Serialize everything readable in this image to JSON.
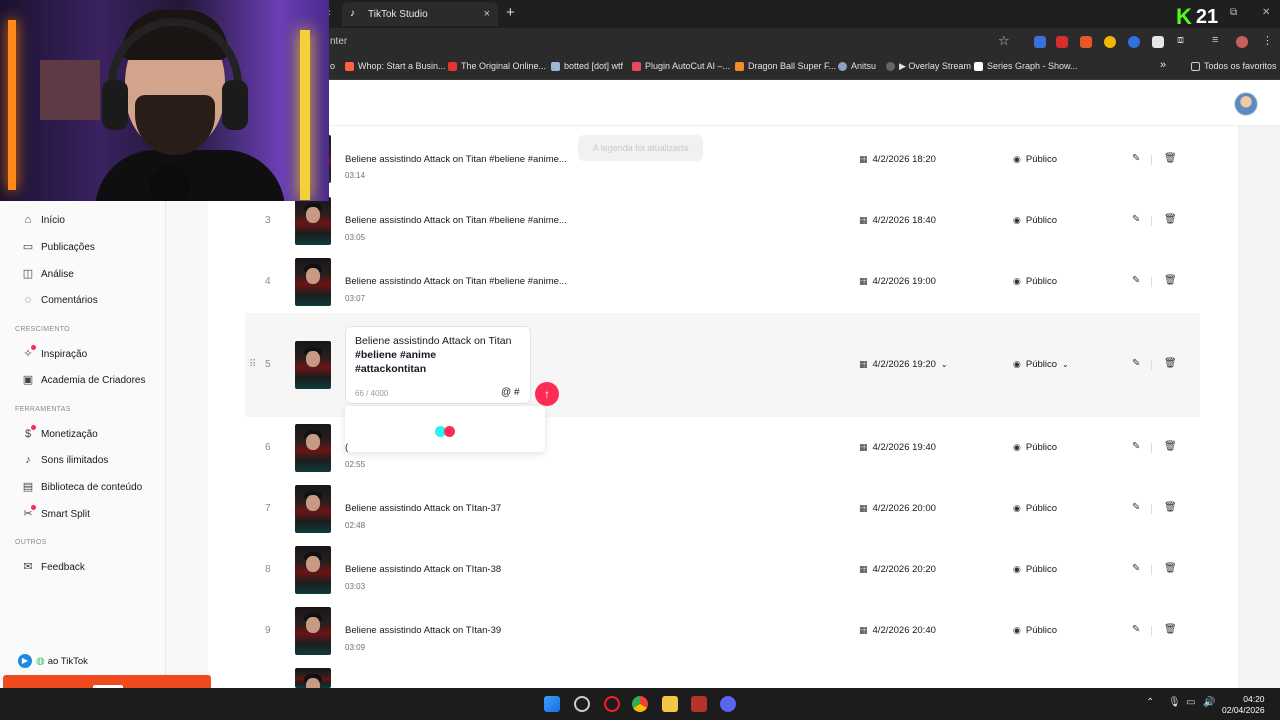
{
  "browser": {
    "tab_title": "TikTok Studio",
    "tab_close": "×",
    "new_tab": "+",
    "url_fragment": "nter",
    "kick_count": "21",
    "bookmarks": [
      {
        "label": "Whop: Start a Busin...",
        "color": "#ff6243"
      },
      {
        "label": "The Original Online...",
        "color": "#e3342f"
      },
      {
        "label": "botted [dot] wtf",
        "color": "#9fb7d6"
      },
      {
        "label": "Plugin AutoCut AI –...",
        "color": "#e84a5f"
      },
      {
        "label": "Dragon Ball Super F...",
        "color": "#f28c28"
      },
      {
        "label": "Anitsu",
        "color": "#8aa3c2"
      },
      {
        "label": "▶ Overlay Stream",
        "color": "#666666"
      },
      {
        "label": "Series Graph - Show...",
        "color": "#ffffff"
      }
    ],
    "bookmarks_more": "»",
    "all_bookmarks": "Todos os favoritos"
  },
  "sidebar": {
    "items": [
      {
        "label": "Início",
        "icon": "home-icon",
        "glyph": "⌂"
      },
      {
        "label": "Publicações",
        "icon": "posts-icon",
        "glyph": "▭"
      },
      {
        "label": "Análise",
        "icon": "analytics-icon",
        "glyph": "◫"
      },
      {
        "label": "Comentários",
        "icon": "comments-icon",
        "glyph": "◌"
      }
    ],
    "section_growth": "CRESCIMENTO",
    "growth_items": [
      {
        "label": "Inspiração",
        "icon": "lightbulb-icon",
        "glyph": "✧",
        "dot": true
      },
      {
        "label": "Academia de Criadores",
        "icon": "academy-icon",
        "glyph": "▣",
        "dot": false
      }
    ],
    "section_tools": "FERRAMENTAS",
    "tool_items": [
      {
        "label": "Monetização",
        "icon": "monetization-icon",
        "glyph": "$",
        "dot": true
      },
      {
        "label": "Sons ilimitados",
        "icon": "music-icon",
        "glyph": "♪",
        "dot": false
      },
      {
        "label": "Biblioteca de conteúdo",
        "icon": "library-icon",
        "glyph": "▤",
        "dot": false
      },
      {
        "label": "Smart Split",
        "icon": "scissors-icon",
        "glyph": "✂",
        "dot": true
      }
    ],
    "section_others": "OUTROS",
    "other_items": [
      {
        "label": "Feedback",
        "icon": "feedback-icon",
        "glyph": "✉"
      }
    ],
    "back_to_tiktok": "ao TikTok"
  },
  "toast": "A legenda foi atualizada",
  "posts": [
    {
      "num": "",
      "title": "Beliene assistindo Attack on Titan #beliene #anime...",
      "duration": "03:14",
      "date": "4/2/2026 18:20",
      "visibility": "Público"
    },
    {
      "num": "3",
      "title": "Beliene assistindo Attack on Titan #beliene #anime...",
      "duration": "03:05",
      "date": "4/2/2026 18:40",
      "visibility": "Público"
    },
    {
      "num": "4",
      "title": "Beliene assistindo Attack on Titan #beliene #anime...",
      "duration": "03:07",
      "date": "4/2/2026 19:00",
      "visibility": "Público"
    },
    {
      "num": "5",
      "title": "",
      "duration": "",
      "date": "4/2/2026 19:20",
      "visibility": "Público"
    },
    {
      "num": "6",
      "title": "(",
      "duration": "02:55",
      "date": "4/2/2026 19:40",
      "visibility": "Público"
    },
    {
      "num": "7",
      "title": "Beliene assistindo Attack on TItan-37",
      "duration": "02:48",
      "date": "4/2/2026 20:00",
      "visibility": "Público"
    },
    {
      "num": "8",
      "title": "Beliene assistindo Attack on TItan-38",
      "duration": "03:03",
      "date": "4/2/2026 20:20",
      "visibility": "Público"
    },
    {
      "num": "9",
      "title": "Beliene assistindo Attack on TItan-39",
      "duration": "03:09",
      "date": "4/2/2026 20:40",
      "visibility": "Público"
    }
  ],
  "editor": {
    "text_plain": "Beliene assistindo Attack on Titan",
    "tag1": "#beliene",
    "tag2": "#anime",
    "tag3": "#attackontitan",
    "counter": "66 / 4000",
    "mention": "@",
    "hashtag": "#",
    "send": "↑"
  },
  "taskbar": {
    "time": "04:20",
    "date": "02/04/2026"
  },
  "colors": {
    "accent": "#fe2c55",
    "loader_cyan": "#25f4ee",
    "loader_red": "#fe2c55",
    "overlay": "#ef4a1e"
  }
}
